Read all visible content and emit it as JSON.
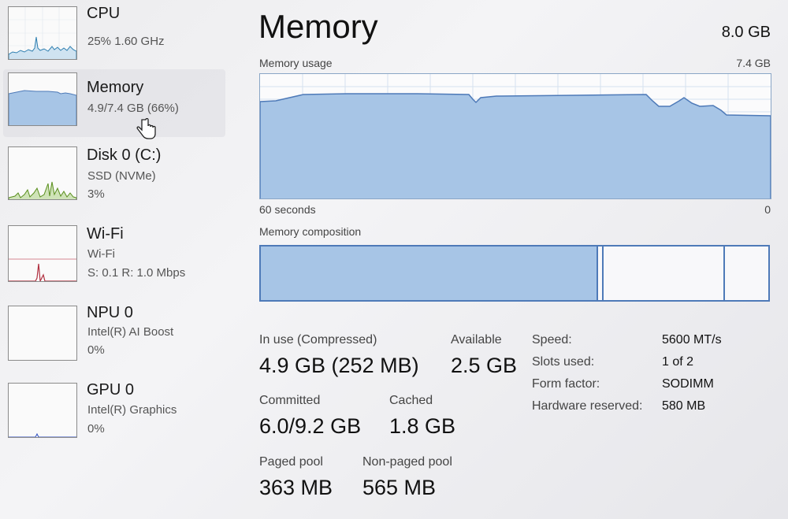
{
  "sidebar": {
    "items": [
      {
        "title": "CPU",
        "sub1": "25%  1.60 GHz",
        "sub2": ""
      },
      {
        "title": "Memory",
        "sub1": "4.9/7.4 GB (66%)",
        "sub2": ""
      },
      {
        "title": "Disk 0 (C:)",
        "sub1": "SSD (NVMe)",
        "sub2": "3%"
      },
      {
        "title": "Wi-Fi",
        "sub1": "Wi-Fi",
        "sub2": "S: 0.1  R: 1.0 Mbps"
      },
      {
        "title": "NPU 0",
        "sub1": "Intel(R) AI Boost",
        "sub2": "0%"
      },
      {
        "title": "GPU 0",
        "sub1": "Intel(R) Graphics",
        "sub2": "0%"
      }
    ]
  },
  "main": {
    "title": "Memory",
    "total": "8.0 GB",
    "usage_label": "Memory usage",
    "usage_max": "7.4 GB",
    "time_left": "60 seconds",
    "time_right": "0",
    "composition_label": "Memory composition"
  },
  "stats": {
    "in_use_label": "In use (Compressed)",
    "in_use_value": "4.9 GB (252 MB)",
    "available_label": "Available",
    "available_value": "2.5 GB",
    "committed_label": "Committed",
    "committed_value": "6.0/9.2 GB",
    "cached_label": "Cached",
    "cached_value": "1.8 GB",
    "paged_label": "Paged pool",
    "paged_value": "363 MB",
    "nonpaged_label": "Non-paged pool",
    "nonpaged_value": "565 MB"
  },
  "specs": [
    {
      "label": "Speed:",
      "value": "5600 MT/s"
    },
    {
      "label": "Slots used:",
      "value": "1 of 2"
    },
    {
      "label": "Form factor:",
      "value": "SODIMM"
    },
    {
      "label": "Hardware reserved:",
      "value": "580 MB"
    }
  ],
  "colors": {
    "memory_fill": "#a7c5e6",
    "memory_line": "#4e7ab8",
    "cpu_line": "#2f7fb0",
    "disk_line": "#5a8f1e",
    "wifi_line": "#b03040",
    "gpu_line": "#3050c0"
  },
  "icons": {
    "cursor": "hand-pointer-icon"
  }
}
